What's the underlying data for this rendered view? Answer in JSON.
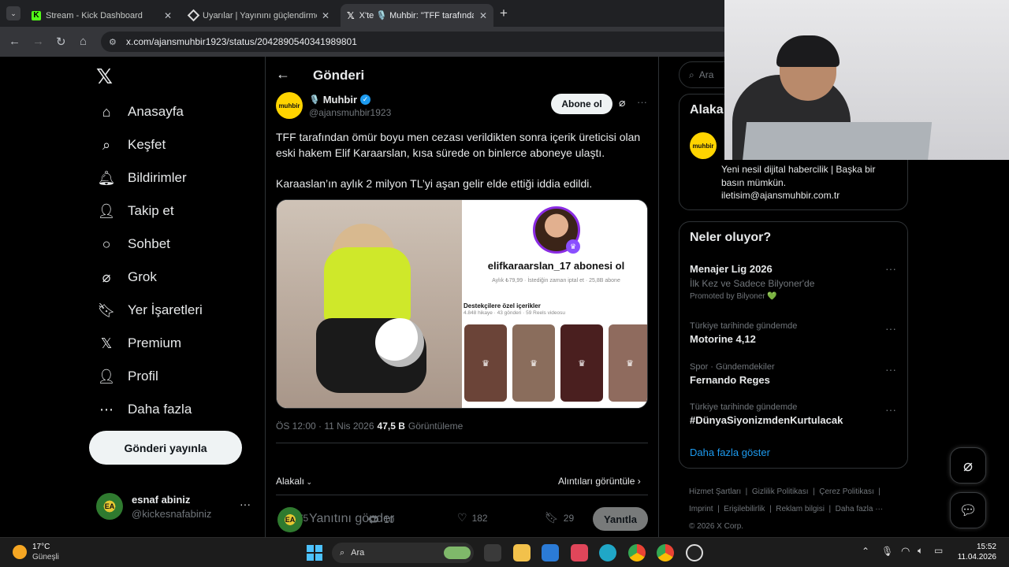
{
  "browser": {
    "tabs": [
      {
        "title": "Stream - Kick Dashboard"
      },
      {
        "title": "Uyarılar | Yayınını güçlendirmek"
      },
      {
        "title": "X'te 🎙️ Muhbir: \"TFF tarafından"
      }
    ],
    "url": "x.com/ajansmuhbir1923/status/2042890540341989801"
  },
  "nav": {
    "items": [
      {
        "label": "Anasayfa",
        "icon": "home-icon"
      },
      {
        "label": "Keşfet",
        "icon": "search-icon"
      },
      {
        "label": "Bildirimler",
        "icon": "bell-icon"
      },
      {
        "label": "Takip et",
        "icon": "add-user-icon"
      },
      {
        "label": "Sohbet",
        "icon": "chat-icon"
      },
      {
        "label": "Grok",
        "icon": "grok-icon"
      },
      {
        "label": "Yer İşaretleri",
        "icon": "bookmark-icon"
      },
      {
        "label": "Premium",
        "icon": "x-logo-icon"
      },
      {
        "label": "Profil",
        "icon": "user-icon"
      },
      {
        "label": "Daha fazla",
        "icon": "more-circle-icon"
      }
    ],
    "post_button": "Gönderi yayınla",
    "account": {
      "name": "esnaf abiniz",
      "handle": "@kickesnafabiniz",
      "avatar_text": "EA"
    }
  },
  "post": {
    "header_title": "Gönderi",
    "author": {
      "name": "Muhbir",
      "handle": "@ajansmuhbir1923",
      "avatar_text": "muhbir"
    },
    "subscribe_label": "Abone ol",
    "text_1": "TFF tarafından ömür boyu men cezası verildikten sonra içerik üreticisi olan eski hakem Elif Karaarslan, kısa sürede on binlerce aboneye ulaştı.",
    "text_2": "Karaaslan’ın aylık 2 milyon TL’yi aşan gelir elde ettiği iddia edildi.",
    "media": {
      "profile_name": "elifkaraarslan_17 abonesi ol",
      "price_line": "Aylık ₺79,99 · İstediğin zaman iptal et · 25,8B abone",
      "section_title": "Destekçilere özel içerikler",
      "section_sub": "4.848 hikaye · 43 gönderi · 59 Reels videosu"
    },
    "time": "ÖS 12:00 · 11 Nis 2026",
    "views_count": "47,5 B",
    "views_label": "Görüntüleme",
    "actions": {
      "replies": "75",
      "reposts": "10",
      "likes": "182",
      "bookmarks": "29"
    },
    "relevant_label": "Alakalı",
    "quotes_label": "Alıntıları görüntüle",
    "reply_placeholder": "Yanıtını gönder",
    "reply_button": "Yanıtla"
  },
  "sidebar": {
    "search_placeholder": "Ara",
    "relevant_title": "Alaka",
    "bio": "Yeni nesil dijital habercilik | Başka bir basın mümkün. iletisim@ajansmuhbir.com.tr",
    "trends_title": "Neler oluyor?",
    "trends": [
      {
        "context": "",
        "title": "Menajer Lig 2026",
        "sub": "İlk Kez ve Sadece Bilyoner'de",
        "promo": "Promoted by Bilyoner 💚"
      },
      {
        "context": "Türkiye tarihinde gündemde",
        "title": "Motorine 4,12"
      },
      {
        "context": "Spor · Gündemdekiler",
        "title": "Fernando Reges"
      },
      {
        "context": "Türkiye tarihinde gündemde",
        "title": "#DünyaSiyonizmdenKurtulacak"
      }
    ],
    "show_more": "Daha fazla göster",
    "footer": [
      "Hizmet Şartları",
      "Gizlilik Politikası",
      "Çerez Politikası",
      "Imprint",
      "Erişilebilirlik",
      "Reklam bilgisi",
      "Daha fazla ···",
      "© 2026 X Corp."
    ]
  },
  "taskbar": {
    "weather_temp": "17°C",
    "weather_desc": "Güneşli",
    "search_label": "Ara",
    "time": "15:52",
    "date": "11.04.2026"
  }
}
